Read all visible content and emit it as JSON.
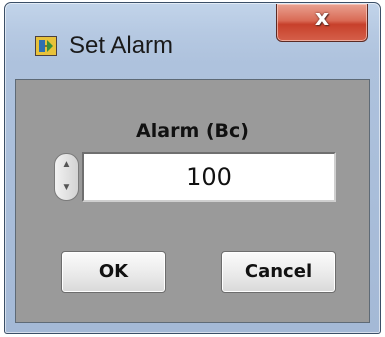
{
  "window": {
    "title": "Set Alarm",
    "icon": "labview-vi-icon",
    "close_label": "x"
  },
  "dialog": {
    "field_label": "Alarm (Bc)",
    "field_value": "100",
    "spinner": {
      "up_glyph": "▲",
      "down_glyph": "▼"
    },
    "ok_label": "OK",
    "cancel_label": "Cancel"
  },
  "colors": {
    "frame": "#b6c9e2",
    "client_background": "#9a9a9a",
    "close_button": "#c7402b"
  }
}
